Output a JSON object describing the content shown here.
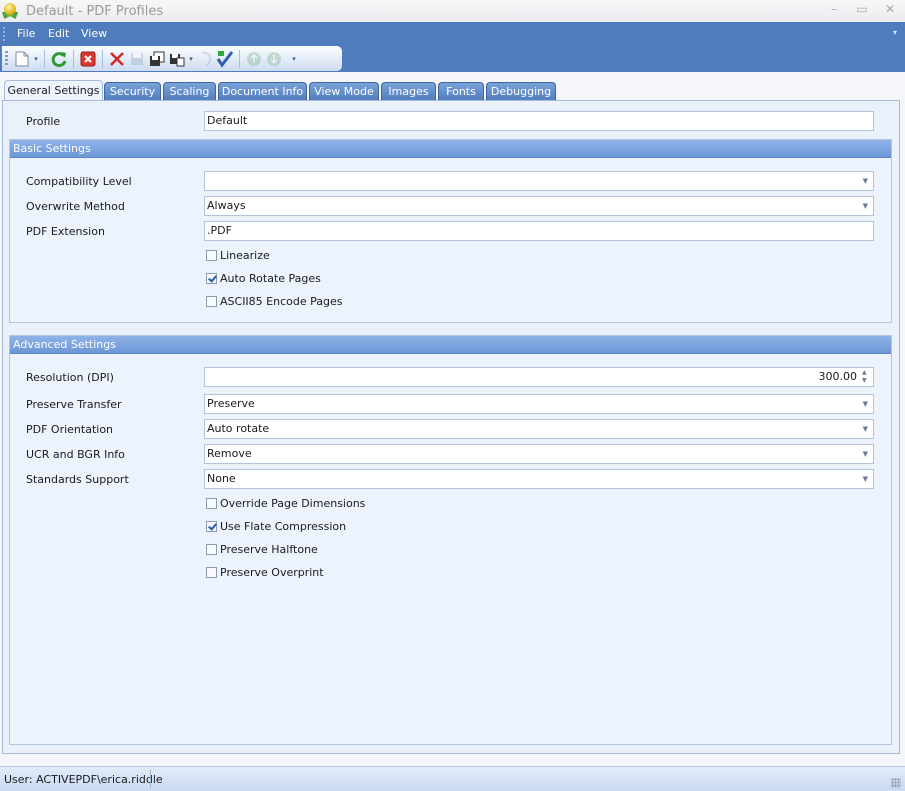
{
  "window": {
    "title": "Default - PDF Profiles",
    "controls": {
      "minimize": "–",
      "maximize": "▭",
      "close": "✕"
    }
  },
  "menu": {
    "items": [
      {
        "label": "File"
      },
      {
        "label": "Edit"
      },
      {
        "label": "View"
      }
    ],
    "overflow_icon": "▾"
  },
  "toolbar": {
    "buttons": [
      {
        "name": "new-profile",
        "icon": "new-document-icon",
        "has_dropdown": true,
        "enabled": true
      },
      {
        "name": "refresh",
        "icon": "refresh-icon",
        "enabled": true
      },
      {
        "name": "close-profile",
        "icon": "close-box-icon",
        "enabled": true
      },
      {
        "name": "delete",
        "icon": "delete-x-icon",
        "enabled": true
      },
      {
        "name": "save",
        "icon": "save-icon",
        "enabled": false
      },
      {
        "name": "save-copy",
        "icon": "save-copy-icon",
        "enabled": true
      },
      {
        "name": "export",
        "icon": "export-icon",
        "has_dropdown": true,
        "enabled": true
      },
      {
        "name": "undo",
        "icon": "undo-icon",
        "enabled": false
      },
      {
        "name": "validate",
        "icon": "checkmark-icon",
        "enabled": true
      },
      {
        "name": "move-up",
        "icon": "arrow-up-icon",
        "enabled": false
      },
      {
        "name": "move-down",
        "icon": "arrow-down-icon",
        "enabled": false
      }
    ],
    "overflow_icon": "▾"
  },
  "tabs": [
    {
      "label": "General Settings",
      "active": true
    },
    {
      "label": "Security"
    },
    {
      "label": "Scaling"
    },
    {
      "label": "Document Info"
    },
    {
      "label": "View Mode"
    },
    {
      "label": "Images"
    },
    {
      "label": "Fonts"
    },
    {
      "label": "Debugging"
    }
  ],
  "profile": {
    "label": "Profile",
    "value": "Default"
  },
  "basic": {
    "title": "Basic Settings",
    "compatibility_level": {
      "label": "Compatibility Level",
      "value": ""
    },
    "overwrite_method": {
      "label": "Overwrite Method",
      "value": "Always"
    },
    "pdf_extension": {
      "label": "PDF Extension",
      "value": ".PDF"
    },
    "checks": [
      {
        "label": "Linearize",
        "checked": false
      },
      {
        "label": "Auto Rotate Pages",
        "checked": true
      },
      {
        "label": "ASCII85 Encode Pages",
        "checked": false
      }
    ]
  },
  "advanced": {
    "title": "Advanced Settings",
    "resolution": {
      "label": "Resolution (DPI)",
      "value": "300.00"
    },
    "preserve_transfer": {
      "label": "Preserve Transfer",
      "value": "Preserve"
    },
    "pdf_orientation": {
      "label": "PDF Orientation",
      "value": "Auto rotate"
    },
    "ucr_bgr": {
      "label": "UCR and BGR Info",
      "value": "Remove"
    },
    "standards_support": {
      "label": "Standards Support",
      "value": "None"
    },
    "checks": [
      {
        "label": "Override Page Dimensions",
        "checked": false
      },
      {
        "label": "Use Flate Compression",
        "checked": true
      },
      {
        "label": "Preserve Halftone",
        "checked": false
      },
      {
        "label": "Preserve Overprint",
        "checked": false
      }
    ]
  },
  "dropdown_arrow": "▼",
  "spin_up": "▲",
  "spin_down": "▼",
  "status": {
    "user": "User: ACTIVEPDF\\erica.riddle"
  }
}
